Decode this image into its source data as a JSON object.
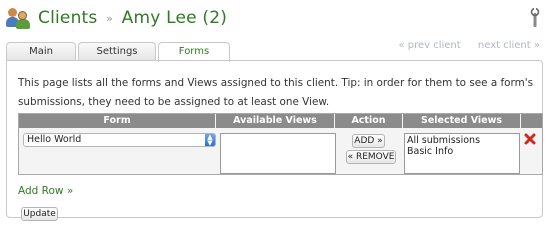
{
  "header": {
    "section": "Clients",
    "separator": "»",
    "client_name": "Amy Lee (2)"
  },
  "tabs": [
    {
      "label": "Main"
    },
    {
      "label": "Settings"
    },
    {
      "label": "Forms"
    }
  ],
  "nav": {
    "prev": "« prev client",
    "next": "next client »"
  },
  "intro_text": "This page lists all the forms and Views assigned to this client. Tip: in order for them to see a form's submissions, they need to be assigned to at least one View.",
  "table": {
    "headers": [
      "Form",
      "Available Views",
      "Action",
      "Selected Views"
    ],
    "row": {
      "form_value": "Hello World",
      "add_label": "ADD »",
      "remove_label": "« REMOVE",
      "selected_views": [
        "All submissions",
        "Basic Info"
      ]
    }
  },
  "add_row_label": "Add Row »",
  "update_label": "Update",
  "colors": {
    "title_green": "#2f7a23",
    "header_gray": "#8b8b8b",
    "nav_disabled": "#b0b8c4"
  }
}
